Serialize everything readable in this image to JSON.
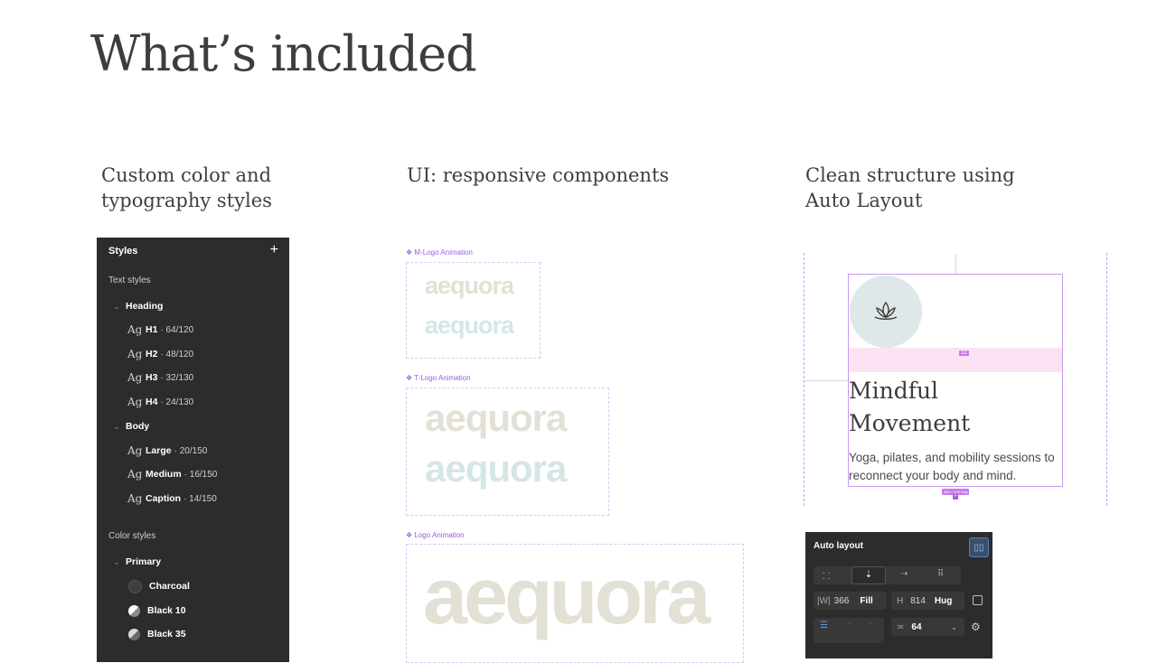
{
  "title": "What’s included",
  "columns": [
    {
      "title": "Custom color and\ntypography styles"
    },
    {
      "title": "UI: responsive components"
    },
    {
      "title": "Clean structure using\nAuto Layout"
    }
  ],
  "styles_panel": {
    "header": "Styles",
    "add_icon": "plus-icon",
    "text_styles_label": "Text styles",
    "groups": [
      {
        "name": "Heading",
        "items": [
          {
            "name": "H1",
            "meta": "· 64/120"
          },
          {
            "name": "H2",
            "meta": "· 48/120"
          },
          {
            "name": "H3",
            "meta": "· 32/130"
          },
          {
            "name": "H4",
            "meta": "· 24/130"
          }
        ]
      },
      {
        "name": "Body",
        "items": [
          {
            "name": "Large",
            "meta": "· 20/150"
          },
          {
            "name": "Medium",
            "meta": "· 16/150"
          },
          {
            "name": "Caption",
            "meta": "· 14/150"
          }
        ]
      }
    ],
    "ag_glyph": "Ag",
    "color_styles_label": "Color styles",
    "color_group": "Primary",
    "colors": [
      {
        "name": "Charcoal",
        "hex": "#3a3a3a"
      },
      {
        "name": "Black 10",
        "hex": "#e6e6e6"
      },
      {
        "name": "Black 35",
        "hex": "#a6a6a6"
      }
    ]
  },
  "components": [
    {
      "label": "❖ M-Logo Animation",
      "logo": "aequora"
    },
    {
      "label": "❖ T-Logo Animation",
      "logo": "aequora"
    },
    {
      "label": "❖ Logo Animation",
      "logo": "aequora"
    }
  ],
  "card": {
    "icon": "lotus-icon",
    "title": "Mindful\nMovement",
    "body": "Yoga, pilates, and mobility sessions to reconnect your body and mind.",
    "spacing_badge": "32",
    "size_badge": "366 × 378 Hug"
  },
  "auto_layout": {
    "title": "Auto layout",
    "width_label": "|W|",
    "width_value": "366",
    "width_mode": "Fill",
    "height_label": "H",
    "height_value": "814",
    "height_mode": "Hug",
    "gap_value": "64"
  },
  "colors": {
    "logo_beige": "#e3e0d6",
    "logo_mint": "#d5e6e6",
    "accent": "#9b5de5",
    "circle": "#dfe8e8",
    "pink": "#fbe3f3"
  }
}
